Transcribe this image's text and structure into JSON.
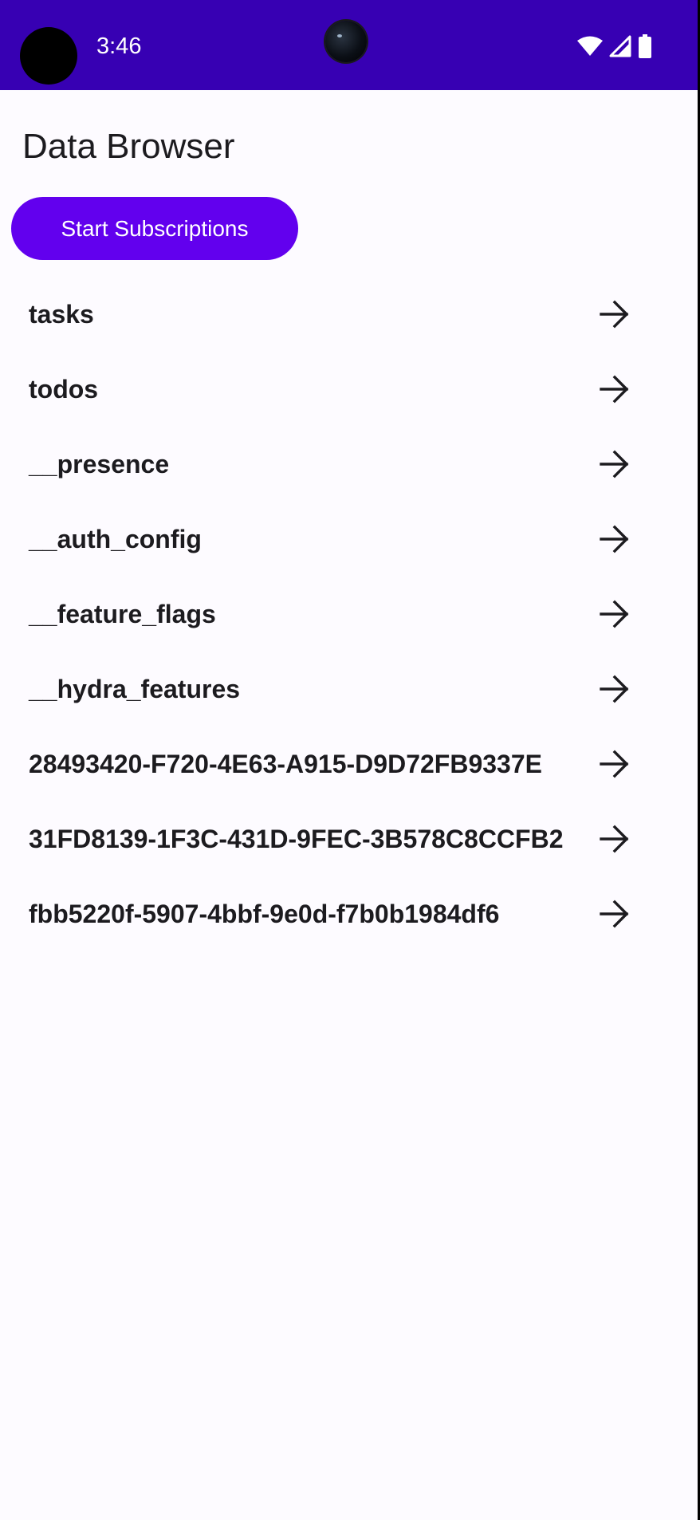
{
  "status_bar": {
    "time": "3:46",
    "background": "#3700b3",
    "icons": [
      "wifi-icon",
      "signal-icon",
      "battery-icon"
    ]
  },
  "header": {
    "title": "Data Browser"
  },
  "actions": {
    "start_subscriptions_label": "Start Subscriptions",
    "accent": "#6200ee"
  },
  "collections": [
    {
      "label": "tasks",
      "icon": "arrow-right-icon"
    },
    {
      "label": "todos",
      "icon": "arrow-right-icon"
    },
    {
      "label": "__presence",
      "icon": "arrow-right-icon"
    },
    {
      "label": "__auth_config",
      "icon": "arrow-right-icon"
    },
    {
      "label": "__feature_flags",
      "icon": "arrow-right-icon"
    },
    {
      "label": "__hydra_features",
      "icon": "arrow-right-icon"
    },
    {
      "label": "28493420-F720-4E63-A915-D9D72FB9337E",
      "icon": "arrow-right-icon"
    },
    {
      "label": "31FD8139-1F3C-431D-9FEC-3B578C8CCFB2",
      "icon": "arrow-right-icon"
    },
    {
      "label": "fbb5220f-5907-4bbf-9e0d-f7b0b1984df6",
      "icon": "arrow-right-icon"
    }
  ]
}
